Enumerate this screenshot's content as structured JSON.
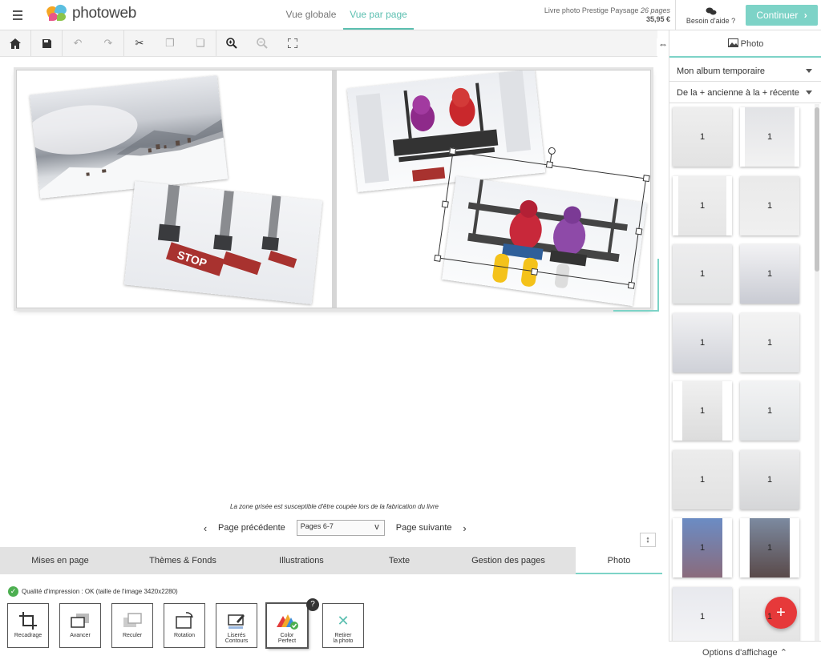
{
  "header": {
    "brand": "photoweb",
    "tabs": [
      {
        "label": "Vue globale",
        "active": false
      },
      {
        "label": "Vue par page",
        "active": true
      }
    ],
    "product": {
      "name": "Livre photo Prestige Paysage",
      "pages": "26 pages",
      "price": "35,95 €"
    },
    "help_label": "Besoin d'aide ?",
    "continue_label": "Continuer"
  },
  "toolbar": {
    "icons": [
      "home-icon",
      "save-icon",
      "undo-icon",
      "redo-icon",
      "cut-icon",
      "copy-icon",
      "paste-icon",
      "zoom-in-icon",
      "zoom-out-icon",
      "fullscreen-icon"
    ]
  },
  "canvas": {
    "notice": "La zone grisée est susceptible d'être coupée lors de la fabrication du livre",
    "prev_label": "Page précédente",
    "next_label": "Page suivante",
    "page_select": "Pages 6-7"
  },
  "bottom_tabs": [
    {
      "label": "Mises en page",
      "active": false
    },
    {
      "label": "Thèmes & Fonds",
      "active": false
    },
    {
      "label": "Illustrations",
      "active": false
    },
    {
      "label": "Texte",
      "active": false
    },
    {
      "label": "Gestion des pages",
      "active": false
    },
    {
      "label": "Photo",
      "active": true
    }
  ],
  "photo_panel": {
    "quality": "Qualité d'impression : OK (taille de l'image 3420x2280)",
    "tools": [
      {
        "label": "Recadrage",
        "icon": "crop-icon"
      },
      {
        "label": "Avancer",
        "icon": "bring-forward-icon"
      },
      {
        "label": "Reculer",
        "icon": "send-backward-icon"
      },
      {
        "label": "Rotation",
        "icon": "rotate-icon"
      },
      {
        "label1": "Liserés",
        "label2": "Contours",
        "icon": "border-icon"
      },
      {
        "label1": "Color",
        "label2": "Perfect",
        "icon": "color-perfect-icon"
      },
      {
        "label1": "Retirer",
        "label2": "la photo",
        "icon": "remove-icon"
      }
    ],
    "help_badge": "?"
  },
  "sidebar": {
    "tab_label": "Photo",
    "album_select": "Mon album temporaire",
    "sort_select": "De la + ancienne à la + récente",
    "thumb_count_label": "1",
    "options_label": "Options d'affichage",
    "fab_label": "+"
  },
  "colors": {
    "accent": "#7dd3c7",
    "fab": "#e6393a",
    "check": "#4caf50"
  }
}
